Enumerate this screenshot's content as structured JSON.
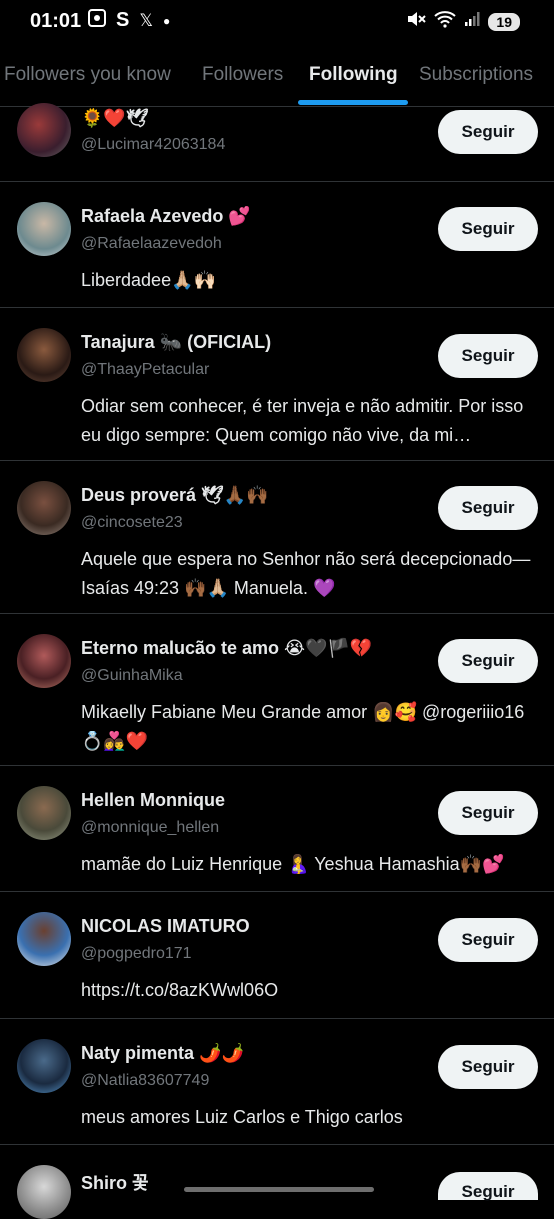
{
  "status_bar": {
    "time": "01:01",
    "battery": "19"
  },
  "tabs": [
    "Followers you know",
    "Followers",
    "Following",
    "Subscriptions"
  ],
  "follow_label": "Seguir",
  "users": [
    {
      "name": "🌻❤️🕊",
      "handle": "@Lucimar42063184",
      "bio": ""
    },
    {
      "name": "Rafaela Azevedo 💕",
      "handle": "@Rafaelaazevedoh",
      "bio": "Liberdadee🙏🏼🙌🏻"
    },
    {
      "name": "Tanajura 🐜 (OFICIAL)",
      "handle": "@ThaayPetacular",
      "bio": "Odiar sem conhecer, é ter inveja e não admitir. Por isso eu digo sempre: Quem comigo não vive, da mi…"
    },
    {
      "name": "Deus proverá 🕊🙏🏾🙌🏾",
      "handle": "@cincosete23",
      "bio": "Aquele que espera no Senhor não será decepcionado— Isaías 49:23 🙌🏾🙏🏼 Manuela. 💜"
    },
    {
      "name": "Eterno malucão te amo 😭🖤🏴💔",
      "handle": "@GuinhaMika",
      "bio": "Mikaelly Fabiane Meu Grande amor 👩🥰 @rogeriiio16 💍👩‍❤️‍👨❤️"
    },
    {
      "name": "Hellen Monnique",
      "handle": "@monnique_hellen",
      "bio": "mamãe do Luiz Henrique 🤱 Yeshua Hamashia🙌🏾💕"
    },
    {
      "name": "NICOLAS IMATURO",
      "handle": "@pogpedro171",
      "bio": "https://t.co/8azKWwl06O"
    },
    {
      "name": "Naty pimenta 🌶️🌶️",
      "handle": "@Natlia83607749",
      "bio": "meus amores Luiz Carlos e Thigo carlos"
    },
    {
      "name": "Shiro 꽃",
      "handle": "",
      "bio": ""
    }
  ],
  "colors": {
    "accent": "#1d9bf0",
    "background": "#000000",
    "button_bg": "#eff3f4"
  }
}
